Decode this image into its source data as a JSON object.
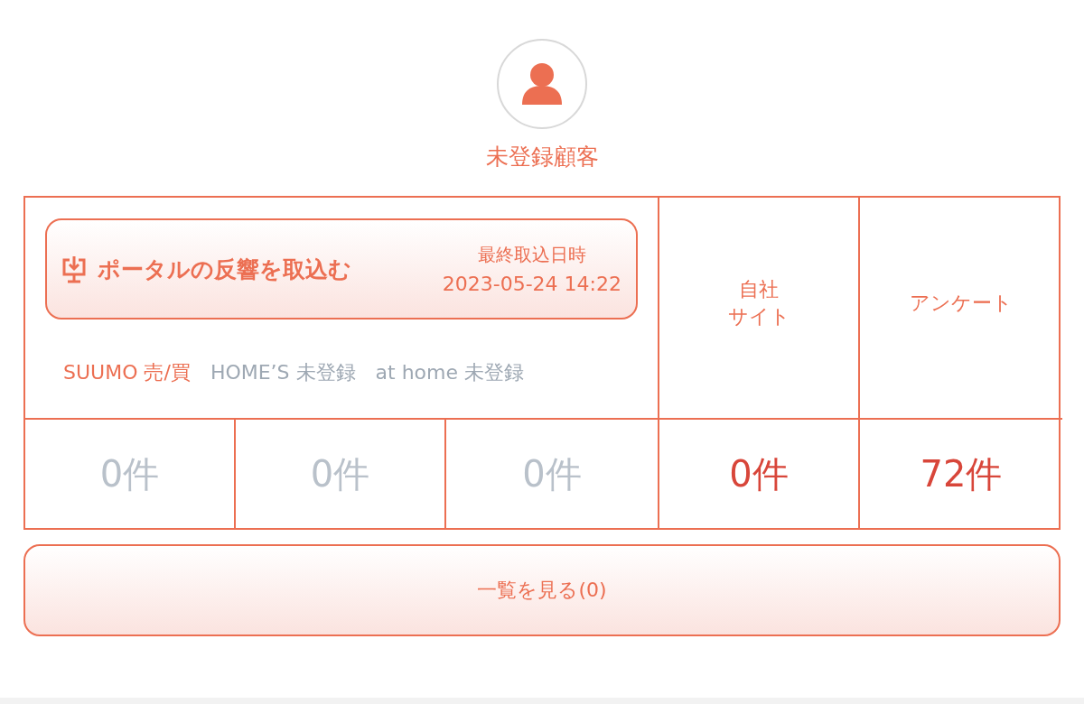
{
  "customer": {
    "name": "未登録顧客"
  },
  "import_button": {
    "label": "ポータルの反響を取込む",
    "last_import_label": "最終取込日時",
    "last_import_time": "2023-05-24 14:22"
  },
  "portals": [
    {
      "name": "SUUMO",
      "status": "売/買",
      "registered": true,
      "count": "0件",
      "count_active": false
    },
    {
      "name": "HOME’S",
      "status": "未登録",
      "registered": false,
      "count": "0件",
      "count_active": false
    },
    {
      "name": "at home",
      "status": "未登録",
      "registered": false,
      "count": "0件",
      "count_active": false
    }
  ],
  "sources": [
    {
      "label_lines": [
        "自社",
        "サイト"
      ],
      "count": "0件",
      "active": true
    },
    {
      "label_lines": [
        "アンケート"
      ],
      "count": "72件",
      "active": true
    }
  ],
  "list_button": {
    "label": "一覧を見る(0)"
  }
}
